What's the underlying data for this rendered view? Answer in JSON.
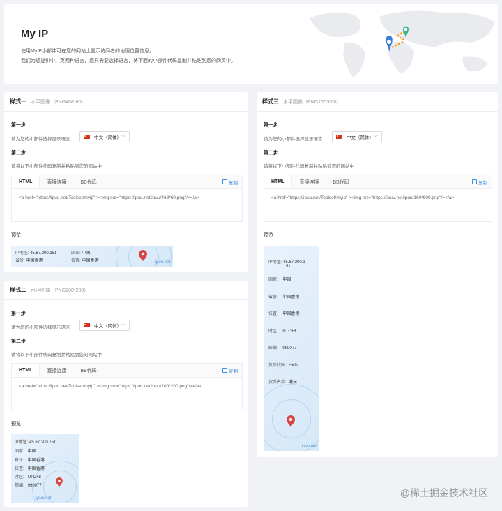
{
  "hero": {
    "title": "My IP",
    "desc_line1": "使用MyIP小部件可在您的网站上显示访问者的地理位置信息。",
    "desc_line2": "我们为您提供中、英两种语言，您只需要选择语言，将下面的小部件代码复制并粘贴到您的网页中。"
  },
  "common": {
    "step1": "第一步",
    "step1_hint": "请为您的小部件选择显示语言",
    "language": "中文（简体）",
    "step2": "第二步",
    "step2_hint": "请将以下小部件代码复制并粘贴到您的网站中",
    "tabs": [
      "HTML",
      "直接连接",
      "BB代码"
    ],
    "copy": "复制",
    "preview": "预览",
    "brand": "ipuu.net"
  },
  "cards": {
    "style1": {
      "name": "样式一",
      "sub": "水平图像（PNG468*60）",
      "code": "<a href=\"https://ipuu.net/Toolset/myip\" ><img src=\"https://ipuu.net/ipuu/468*60.png\"/></a>"
    },
    "style2": {
      "name": "样式二",
      "sub": "水平图像（PNG200*200）",
      "code": "<a href=\"https://ipuu.net/Toolset/myip\" ><img src=\"https://ipuu.net/ipuu/200*200.png\"/></a>"
    },
    "style3": {
      "name": "样式三",
      "sub": "水平图像（PNG160*600）",
      "code": "<a href=\"https://ipuu.net/Toolset/myip\" ><img src=\"https://ipuu.net/ipuu/160*600.png\"/></a>"
    }
  },
  "ipinfo": {
    "ip_label": "IP地址:",
    "ip": "45.67.200.151",
    "ip_wrap_a": "45.67.200.1",
    "ip_wrap_b": "51",
    "country_label": "国家:",
    "country": "中国",
    "province_label": "省份:",
    "province": "中国香港",
    "location_label": "位置:",
    "location": "中国香港",
    "tz_label": "时区:",
    "tz": "UTC+8",
    "zip_label": "邮编:",
    "zip": "999077",
    "currency_code_label": "货币代码:",
    "currency_code": "HKD",
    "currency_name_label": "货币名称:",
    "currency_name": "港元"
  },
  "colors": {
    "accent": "#3a8ee6",
    "pin_red": "#d64541",
    "pin_blue": "#3b7dd8",
    "pin_green": "#2fb38f",
    "route": "#f39c12"
  },
  "watermark": "@稀土掘金技术社区"
}
